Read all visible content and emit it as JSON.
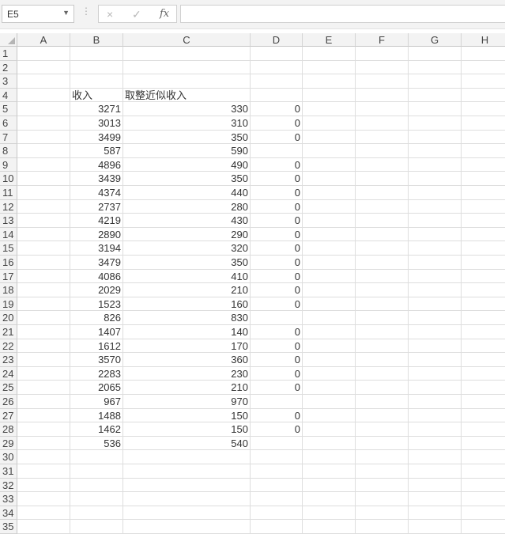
{
  "formula_bar": {
    "name_box": "E5",
    "cancel_icon": "×",
    "enter_icon": "✓",
    "fx_label": "fx",
    "formula": ""
  },
  "columns": [
    "A",
    "B",
    "C",
    "D",
    "E",
    "F",
    "G",
    "H"
  ],
  "rows": [
    {
      "n": "1",
      "B": "",
      "C": "",
      "D": ""
    },
    {
      "n": "2",
      "B": "",
      "C": "",
      "D": ""
    },
    {
      "n": "3",
      "B": "",
      "C": "",
      "D": ""
    },
    {
      "n": "4",
      "B": "收入",
      "C": "取整近似收入",
      "D": ""
    },
    {
      "n": "5",
      "B": "3271",
      "C": "330",
      "D": "0"
    },
    {
      "n": "6",
      "B": "3013",
      "C": "310",
      "D": "0"
    },
    {
      "n": "7",
      "B": "3499",
      "C": "350",
      "D": "0"
    },
    {
      "n": "8",
      "B": "587",
      "C": "590",
      "D": ""
    },
    {
      "n": "9",
      "B": "4896",
      "C": "490",
      "D": "0"
    },
    {
      "n": "10",
      "B": "3439",
      "C": "350",
      "D": "0"
    },
    {
      "n": "11",
      "B": "4374",
      "C": "440",
      "D": "0"
    },
    {
      "n": "12",
      "B": "2737",
      "C": "280",
      "D": "0"
    },
    {
      "n": "13",
      "B": "4219",
      "C": "430",
      "D": "0"
    },
    {
      "n": "14",
      "B": "2890",
      "C": "290",
      "D": "0"
    },
    {
      "n": "15",
      "B": "3194",
      "C": "320",
      "D": "0"
    },
    {
      "n": "16",
      "B": "3479",
      "C": "350",
      "D": "0"
    },
    {
      "n": "17",
      "B": "4086",
      "C": "410",
      "D": "0"
    },
    {
      "n": "18",
      "B": "2029",
      "C": "210",
      "D": "0"
    },
    {
      "n": "19",
      "B": "1523",
      "C": "160",
      "D": "0"
    },
    {
      "n": "20",
      "B": "826",
      "C": "830",
      "D": ""
    },
    {
      "n": "21",
      "B": "1407",
      "C": "140",
      "D": "0"
    },
    {
      "n": "22",
      "B": "1612",
      "C": "170",
      "D": "0"
    },
    {
      "n": "23",
      "B": "3570",
      "C": "360",
      "D": "0"
    },
    {
      "n": "24",
      "B": "2283",
      "C": "230",
      "D": "0"
    },
    {
      "n": "25",
      "B": "2065",
      "C": "210",
      "D": "0"
    },
    {
      "n": "26",
      "B": "967",
      "C": "970",
      "D": ""
    },
    {
      "n": "27",
      "B": "1488",
      "C": "150",
      "D": "0"
    },
    {
      "n": "28",
      "B": "1462",
      "C": "150",
      "D": "0"
    },
    {
      "n": "29",
      "B": "536",
      "C": "540",
      "D": ""
    },
    {
      "n": "30",
      "B": "",
      "C": "",
      "D": ""
    },
    {
      "n": "31",
      "B": "",
      "C": "",
      "D": ""
    },
    {
      "n": "32",
      "B": "",
      "C": "",
      "D": ""
    },
    {
      "n": "33",
      "B": "",
      "C": "",
      "D": ""
    },
    {
      "n": "34",
      "B": "",
      "C": "",
      "D": ""
    },
    {
      "n": "35",
      "B": "",
      "C": "",
      "D": ""
    }
  ]
}
